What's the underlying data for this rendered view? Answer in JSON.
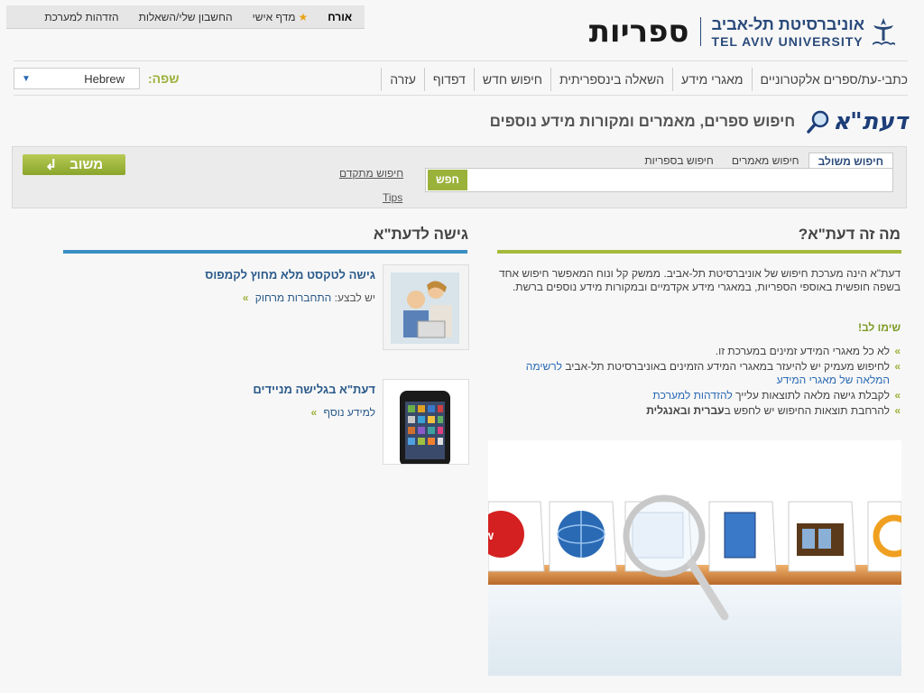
{
  "userbar": {
    "guest": "אורח",
    "shelf": "מדף אישי",
    "account": "החשבון שלי/השאלות",
    "login": "הזדהות למערכת"
  },
  "header": {
    "tau_hebrew": "אוניברסיטת תל-אביב",
    "tau_english": "TEL AVIV UNIVERSITY",
    "libraries": "ספריות"
  },
  "nav": {
    "items": [
      "כתבי-עת/ספרים אלקטרוניים",
      "מאגרי מידע",
      "השאלה בינספריתית",
      "חיפוש חדש",
      "דפדוף",
      "עזרה"
    ],
    "language_label": "שפה:",
    "language_value": "Hebrew"
  },
  "daat": {
    "logo": "דעת\"א",
    "subtitle": "חיפוש ספרים, מאמרים ומקורות מידע נוספים"
  },
  "search": {
    "tabs": [
      "חיפוש משולב",
      "חיפוש מאמרים",
      "חיפוש בספריות"
    ],
    "button": "חפש",
    "advanced": "חיפוש מתקדם",
    "tips": "Tips",
    "feedback": "משוב"
  },
  "what": {
    "title": "מה זה דעת\"א?",
    "text": "דעת\"א הינה מערכת חיפוש של אוניברסיטת תל-אביב. ממשק קל ונוח המאפשר חיפוש אחד בשפה חופשית באוספי הספריות, במאגרי מידע אקדמיים ובמקורות מידע נוספים ברשת.",
    "attention": "שימו לב!",
    "note1": "לא כל מאגרי המידע זמינים במערכת זו.",
    "note2_prefix": "לחיפוש מעמיק יש להיעזר במאגרי המידע הזמינים באוניברסיטת תל-אביב",
    "note2_link": "לרשימה המלאה של מאגרי המידע",
    "note3_prefix": "לקבלת גישה מלאה לתוצאות עלייך",
    "note3_link": "להזדהות למערכת",
    "note4_prefix": "להרחבת תוצאות החיפוש יש לחפש ב",
    "note4_bold": "עברית ובאנגלית"
  },
  "access": {
    "title": "גישה לדעת\"א",
    "item1_title": "גישה לטקסט מלא מחוץ לקמפוס",
    "item1_prefix": "יש לבצע:",
    "item1_link": "התחברות מרחוק",
    "item2_title": "דעת\"א בגלישה מניידים",
    "item2_link": "למידע נוסף"
  },
  "illustration": {
    "www_label": "www"
  },
  "colors": {
    "accent_green": "#9bb23a",
    "accent_blue": "#3a8fc4",
    "brand_navy": "#2a4a7a"
  }
}
